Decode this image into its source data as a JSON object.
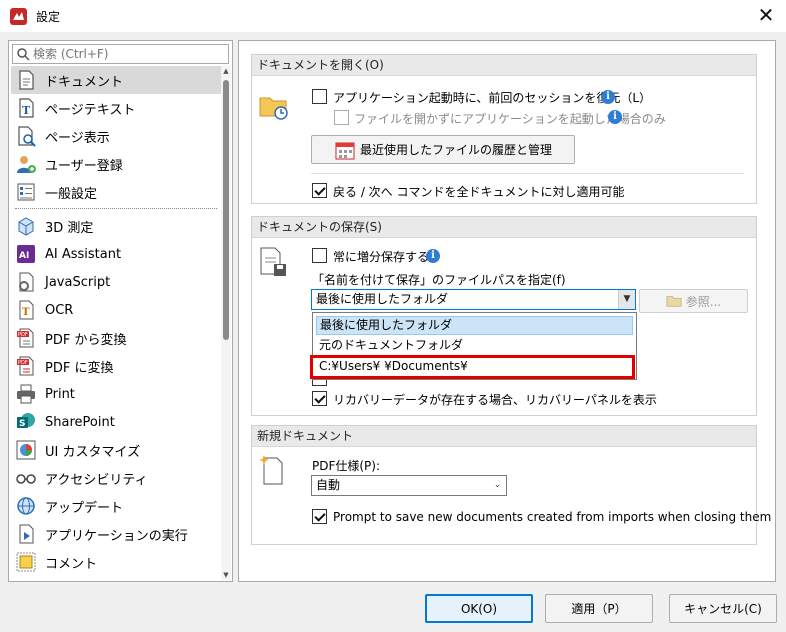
{
  "window": {
    "title": "設定"
  },
  "search": {
    "placeholder": "検索 (Ctrl+F)"
  },
  "nav": {
    "items_top": [
      {
        "label": "ドキュメント",
        "icon": "document-icon"
      },
      {
        "label": "ページテキスト",
        "icon": "page-text-icon"
      },
      {
        "label": "ページ表示",
        "icon": "page-view-icon"
      },
      {
        "label": "ユーザー登録",
        "icon": "user-icon"
      },
      {
        "label": "一般設定",
        "icon": "general-settings-icon"
      }
    ],
    "items_bottom": [
      {
        "label": "3D 測定",
        "icon": "cube-icon"
      },
      {
        "label": "AI Assistant",
        "icon": "ai-icon"
      },
      {
        "label": "JavaScript",
        "icon": "javascript-icon"
      },
      {
        "label": "OCR",
        "icon": "ocr-icon"
      },
      {
        "label": "PDF から変換",
        "icon": "pdf-from-icon"
      },
      {
        "label": "PDF に変換",
        "icon": "pdf-to-icon"
      },
      {
        "label": "Print",
        "icon": "printer-icon"
      },
      {
        "label": "SharePoint",
        "icon": "sharepoint-icon"
      },
      {
        "label": "UI カスタマイズ",
        "icon": "palette-icon"
      },
      {
        "label": "アクセシビリティ",
        "icon": "glasses-icon"
      },
      {
        "label": "アップデート",
        "icon": "globe-icon"
      },
      {
        "label": "アプリケーションの実行",
        "icon": "app-run-icon"
      },
      {
        "label": "コメント",
        "icon": "comment-icon"
      }
    ]
  },
  "open_group": {
    "header": "ドキュメントを開く(O)",
    "restore_session": "アプリケーション起動時に、前回のセッションを復元（L）",
    "restore_without_file": "ファイルを開かずにアプリケーションを起動した場合のみ",
    "history_button": "最近使用したファイルの履歴と管理",
    "back_next": "戻る / 次へ コマンドを全ドキュメントに対し適用可能"
  },
  "save_group": {
    "header": "ドキュメントの保存(S)",
    "incremental_save": "常に増分保存する",
    "save_as_path_label": "「名前を付けて保存」のファイルパスを指定(f)",
    "path_selected": "最後に使用したフォルダ",
    "browse_button": "参照...",
    "path_options": [
      "最後に使用したフォルダ",
      "元のドキュメントフォルダ",
      "C:¥Users¥                ¥Documents¥"
    ],
    "recovery_panel": "リカバリーデータが存在する場合、リカバリーパネルを表示"
  },
  "new_group": {
    "header": "新規ドキュメント",
    "pdf_spec_label": "PDF仕様(P):",
    "pdf_spec_value": "自動",
    "prompt_save": "Prompt to save new documents created from imports when closing them"
  },
  "buttons": {
    "ok": "OK(O)",
    "apply": "適用（P）",
    "cancel": "キャンセル(C)"
  },
  "colors": {
    "accent": "#0078d7",
    "highlight_box": "#e00000",
    "info": "#2e7dd2"
  }
}
